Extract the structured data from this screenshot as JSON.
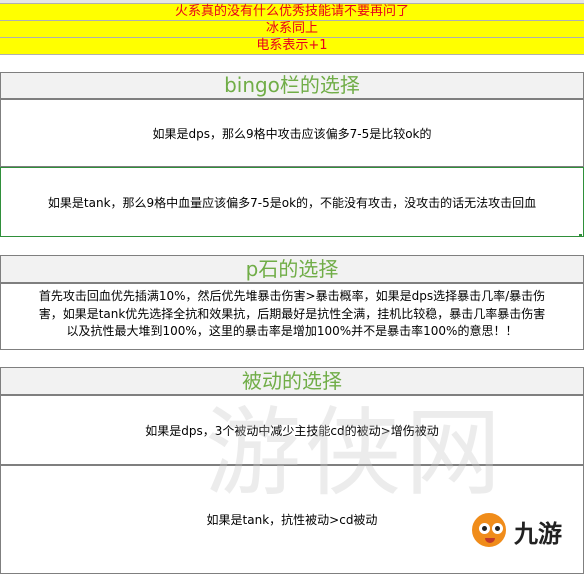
{
  "top_rows": [
    "火系真的没有什么优秀技能请不要再问了",
    "冰系同上",
    "电系表示+1"
  ],
  "sections": {
    "bingo": {
      "title": "bingo栏的选择",
      "dps_text": "如果是dps，那么9格中攻击应该偏多7-5是比较ok的",
      "tank_text": "如果是tank，那么9格中血量应该偏多7-5是ok的，不能没有攻击，没攻击的话无法攻击回血"
    },
    "pstone": {
      "title": "p石的选择",
      "paragraph_lines": [
        "首先攻击回血优先插满10%，然后优先堆暴击伤害>暴击概率，如果是dps选择暴击几率/暴击伤",
        "害，如果是tank优先选择全抗和效果抗，后期最好是抗性全满，挂机比较稳，暴击几率暴击伤害",
        "以及抗性最大堆到100%，这里的暴击率是增加100%并不是暴击率100%的意思！！"
      ]
    },
    "passive": {
      "title": "被动的选择",
      "dps_text": "如果是dps，3个被动中减少主技能cd的被动>增伤被动",
      "tank_text": "如果是tank，抗性被动>cd被动"
    }
  },
  "watermark": "游侠网",
  "logo": {
    "text": "九游",
    "color": "#f08c1a"
  }
}
